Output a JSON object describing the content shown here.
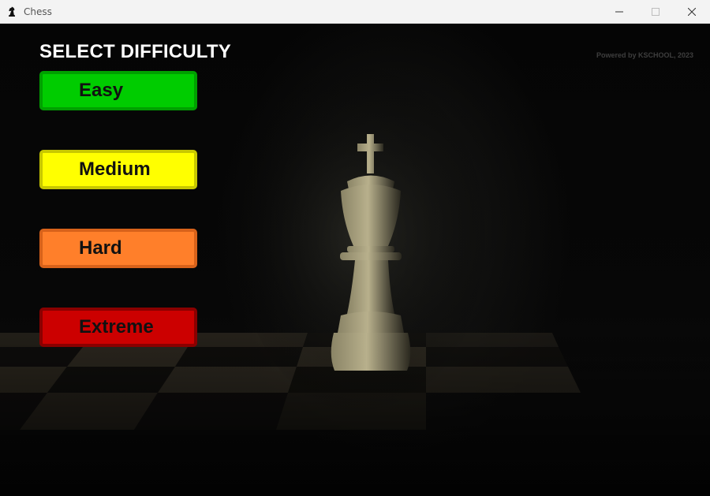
{
  "window": {
    "title": "Chess",
    "app_icon": "chess-knight-icon",
    "controls": [
      "minimize-icon",
      "maximize-icon",
      "close-icon"
    ]
  },
  "menu": {
    "heading": "SELECT DIFFICULTY",
    "credit": "Powered by KSCHOOL, 2023",
    "buttons": [
      {
        "label": "Easy",
        "color": "#00cc00"
      },
      {
        "label": "Medium",
        "color": "#ffff00"
      },
      {
        "label": "Hard",
        "color": "#ff7f2a"
      },
      {
        "label": "Extreme",
        "color": "#cc0000"
      }
    ]
  },
  "background": {
    "subject": "chess-king-piece-image"
  }
}
